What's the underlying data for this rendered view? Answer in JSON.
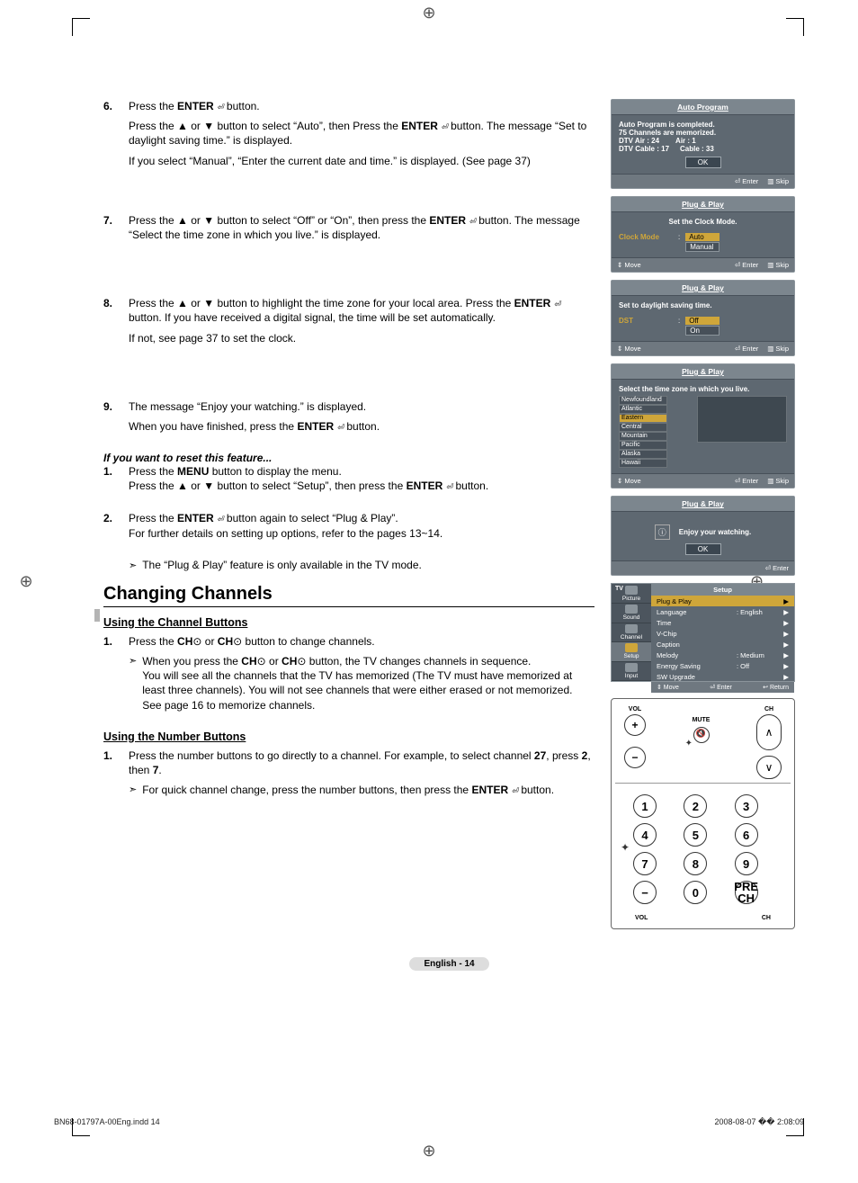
{
  "steps_top": [
    {
      "n": "6.",
      "lines": [
        "Press the <b>ENTER</b> <i class='enter-icon'></i> button.",
        "Press the ▲ or ▼ button to select “Auto”, then Press the <b>ENTER</b> <i class='enter-icon'></i> button. The message “Set to daylight saving time.” is displayed.",
        "If you select “Manual”, “Enter the current date and time.” is displayed. (See page 37)"
      ]
    },
    {
      "n": "7.",
      "lines": [
        "Press the ▲ or ▼ button to select “Off” or “On”, then press the <b>ENTER</b> <i class='enter-icon'></i> button. The message “Select the time zone in which you live.” is displayed."
      ]
    },
    {
      "n": "8.",
      "lines": [
        "Press the ▲ or ▼ button to highlight the time zone for your local area. Press the <b>ENTER</b> <i class='enter-icon'></i> button. If you have received a digital signal, the time will be set automatically.",
        "If not, see page 37 to set the clock."
      ]
    },
    {
      "n": "9.",
      "lines": [
        "The message “Enjoy your watching.” is displayed.",
        "When you have finished, press the <b>ENTER</b> <i class='enter-icon'></i> button."
      ]
    }
  ],
  "reset_heading": "If you want to reset this feature...",
  "reset_steps": [
    {
      "n": "1.",
      "text": "Press the <b>MENU</b> button to display the menu.<br>Press the ▲ or ▼ button to select “Setup”, then press the <b>ENTER</b> <i class='enter-icon'></i> button."
    },
    {
      "n": "2.",
      "text": "Press the <b>ENTER</b> <i class='enter-icon'></i> button again to select “Plug & Play”.<br>For further details on setting up options, refer to the pages 13~14."
    }
  ],
  "reset_note": "The “Plug & Play” feature is only available in the TV mode.",
  "section2": "Changing Channels",
  "sub1": "Using the Channel Buttons",
  "sub1_step": "Press the <b>CH</b>⊙ or <b>CH</b>⊙ button to change channels.",
  "sub1_note": "When you press the <b>CH</b>⊙ or <b>CH</b>⊙ button, the TV changes channels in sequence.<br>You will see all the channels that the TV has memorized (The TV must have memorized at least three channels). You will not see channels that were either erased or not memorized. See page 16 to memorize channels.",
  "sub2": "Using the Number Buttons",
  "sub2_step": "Press the number buttons to go directly to a channel. For example, to select channel <b>27</b>, press <b>2</b>, then <b>7</b>.",
  "sub2_note": "For quick channel change, press the number buttons, then press the <b>ENTER</b> <i class='enter-icon'></i> button.",
  "osd1": {
    "title": "Auto Program",
    "l1": "Auto Program is completed.",
    "l2": "75 Channels are memorized.",
    "l3a": "DTV Air : 24",
    "l3b": "Air : 1",
    "l4a": "DTV Cable : 17",
    "l4b": "Cable : 33",
    "ok": "OK",
    "f1": "⏎ Enter",
    "f2": "▥ Skip"
  },
  "osd2": {
    "title": "Plug & Play",
    "sub": "Set the Clock Mode.",
    "lbl": "Clock Mode",
    "v1": "Auto",
    "v2": "Manual",
    "f0": "⇕ Move",
    "f1": "⏎ Enter",
    "f2": "▥ Skip"
  },
  "osd3": {
    "title": "Plug & Play",
    "sub": "Set to daylight saving time.",
    "lbl": "DST",
    "v1": "Off",
    "v2": "On",
    "f0": "⇕ Move",
    "f1": "⏎ Enter",
    "f2": "▥ Skip"
  },
  "osd4": {
    "title": "Plug & Play",
    "sub": "Select the time zone in which you live.",
    "zones": [
      "Newfoundland",
      "Atlantic",
      "Eastern",
      "Central",
      "Mountain",
      "Pacific",
      "Alaska",
      "Hawaii"
    ],
    "f0": "⇕ Move",
    "f1": "⏎ Enter",
    "f2": "▥ Skip"
  },
  "osd5": {
    "title": "Plug & Play",
    "msg": "Enjoy your watching.",
    "ok": "OK",
    "f1": "⏎ Enter"
  },
  "setup": {
    "tv": "TV",
    "title": "Setup",
    "tabs": [
      "Picture",
      "Sound",
      "Channel",
      "Setup",
      "Input"
    ],
    "rows": [
      {
        "k": "Plug & Play",
        "v": "",
        "active": true
      },
      {
        "k": "Language",
        "v": ": English"
      },
      {
        "k": "Time",
        "v": ""
      },
      {
        "k": "V-Chip",
        "v": ""
      },
      {
        "k": "Caption",
        "v": ""
      },
      {
        "k": "Melody",
        "v": ": Medium"
      },
      {
        "k": "Energy Saving",
        "v": ": Off"
      },
      {
        "k": "SW Upgrade",
        "v": ""
      }
    ],
    "f0": "⇕ Move",
    "f1": "⏎ Enter",
    "f2": "↩ Return"
  },
  "remote": {
    "vol": "VOL",
    "ch": "CH",
    "mute": "MUTE",
    "plus": "+",
    "minus": "−",
    "up": "∧",
    "down": "∨",
    "nums": [
      "1",
      "2",
      "3",
      "4",
      "5",
      "6",
      "7",
      "8",
      "9",
      "−",
      "0"
    ],
    "pre": "PRE\nCH"
  },
  "pagefoot": "English - 14",
  "print_l": "BN68-01797A-00Eng.indd   14",
  "print_r": "2008-08-07   �� 2:08:09"
}
